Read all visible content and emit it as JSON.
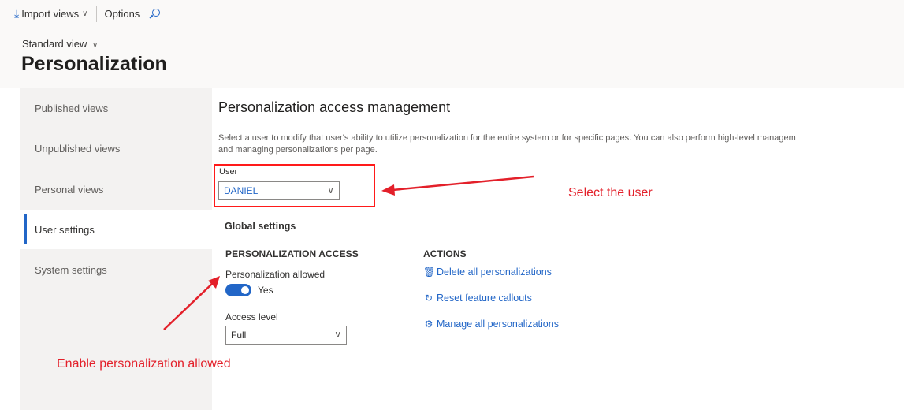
{
  "toolbar": {
    "import_label": "Import views",
    "options_label": "Options"
  },
  "header": {
    "view_selector": "Standard view",
    "title": "Personalization"
  },
  "nav": {
    "items": [
      {
        "label": "Published views"
      },
      {
        "label": "Unpublished views"
      },
      {
        "label": "Personal views"
      },
      {
        "label": "User settings"
      },
      {
        "label": "System settings"
      }
    ],
    "active": "User settings"
  },
  "main": {
    "title": "Personalization access management",
    "description_line1": "Select a user to modify that user's ability to utilize personalization for the entire system or for specific pages. You can also perform high-level managem",
    "description_line2": "and managing personalizations per page.",
    "user_label": "User",
    "user_value": "DANIEL",
    "global_settings": "Global settings",
    "access_heading": "PERSONALIZATION ACCESS",
    "allowed_label": "Personalization allowed",
    "allowed_state": "Yes",
    "allowed_on": true,
    "access_level_label": "Access level",
    "access_level_value": "Full",
    "actions_heading": "ACTIONS",
    "actions": [
      {
        "label": "Delete all personalizations",
        "icon": "trash-icon"
      },
      {
        "label": "Reset feature callouts",
        "icon": "refresh-icon"
      },
      {
        "label": "Manage all personalizations",
        "icon": "gear-icon"
      }
    ]
  },
  "annotations": {
    "select_user": "Select the user",
    "enable_allowed": "Enable personalization allowed",
    "color": "#e3202a"
  },
  "colors": {
    "accent": "#2266c7",
    "highlight_box": "#ff1a1a"
  }
}
